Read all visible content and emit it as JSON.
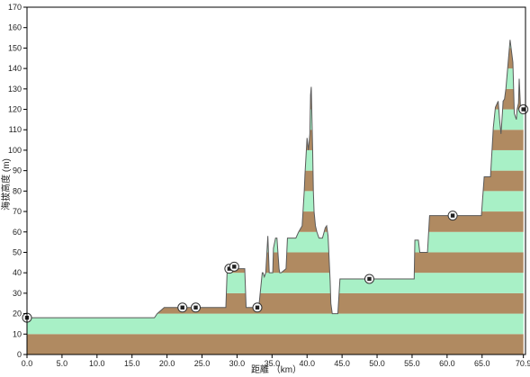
{
  "chart_data": {
    "type": "area",
    "title": "",
    "xlabel": "距離 （km）",
    "ylabel": "海拔高度 (m)",
    "xlim": [
      0,
      71.2
    ],
    "ylim": [
      0,
      170
    ],
    "x_ticks": [
      "0.0",
      "5.0",
      "10.0",
      "15.0",
      "20.0",
      "25.0",
      "30.0",
      "35.0",
      "40.0",
      "45.0",
      "50.0",
      "55.0",
      "60.0",
      "65.0",
      "70.9"
    ],
    "x_tick_values": [
      0,
      5,
      10,
      15,
      20,
      25,
      30,
      35,
      40,
      45,
      50,
      55,
      60,
      65,
      70.9
    ],
    "y_ticks": [
      "0",
      "10",
      "20",
      "30",
      "40",
      "50",
      "60",
      "70",
      "80",
      "90",
      "100",
      "110",
      "120",
      "130",
      "140",
      "150",
      "160",
      "170"
    ],
    "y_tick_values": [
      0,
      10,
      20,
      30,
      40,
      50,
      60,
      70,
      80,
      90,
      100,
      110,
      120,
      130,
      140,
      150,
      160,
      170
    ],
    "band_height": 10,
    "band_colors": [
      "#b08a61",
      "#a8f0c6"
    ],
    "line_color": "#5a5a5a",
    "grid": false,
    "series": [
      {
        "x": [
          0,
          18.2,
          18.6,
          19.6,
          28.4,
          28.6,
          31.1,
          31.3,
          32.9,
          33.1,
          33.6,
          33.7,
          33.9,
          34.1,
          34.4,
          34.6,
          35.1,
          35.2,
          35.5,
          35.7,
          36.0,
          36.1,
          36.3,
          37.0,
          37.2,
          37.4,
          37.8,
          38.1,
          38.4,
          38.8,
          39.3,
          39.6,
          39.7,
          39.9,
          40.0,
          40.2,
          40.4,
          40.5,
          40.6,
          40.8,
          40.9,
          41.0,
          41.2,
          41.4,
          41.7,
          42.0,
          42.2,
          42.6,
          42.8,
          43.0,
          43.3,
          43.4,
          43.6,
          43.8,
          44.1,
          44.4,
          44.7,
          45.0,
          45.2,
          45.3,
          45.6,
          55.3,
          55.4,
          55.9,
          56.1,
          56.3,
          57.2,
          57.5,
          57.6,
          64.7,
          64.9,
          65.3,
          65.7,
          66.0,
          66.2,
          66.6,
          66.9,
          67.3,
          67.5,
          67.7,
          67.9,
          68.0,
          68.2,
          68.4,
          68.7,
          69.0,
          69.4,
          69.6,
          69.8,
          69.9,
          70.0,
          70.2,
          70.3,
          70.5,
          70.9
        ],
        "y": [
          18,
          18,
          20,
          23,
          23,
          42,
          42,
          23,
          23,
          23,
          40,
          40,
          38,
          40,
          58,
          40,
          40,
          52,
          57,
          57,
          42,
          40,
          40,
          42,
          57,
          57,
          57,
          57,
          57,
          60,
          63,
          80,
          88,
          100,
          106,
          100,
          108,
          127,
          131,
          100,
          80,
          70,
          63,
          60,
          57,
          57,
          57,
          62,
          63,
          58,
          36,
          25,
          20,
          20,
          20,
          20,
          37,
          37,
          37,
          37,
          37,
          37,
          56,
          56,
          50,
          50,
          50,
          68,
          68,
          68,
          68,
          87,
          87,
          87,
          87,
          111,
          121,
          124,
          115,
          108,
          118,
          124,
          125,
          130,
          142,
          154,
          143,
          118,
          116,
          115,
          120,
          123,
          135,
          120,
          120
        ]
      }
    ],
    "markers": [
      {
        "x": 0.0,
        "y": 18
      },
      {
        "x": 22.2,
        "y": 23
      },
      {
        "x": 24.1,
        "y": 23
      },
      {
        "x": 28.9,
        "y": 42
      },
      {
        "x": 29.6,
        "y": 43
      },
      {
        "x": 32.9,
        "y": 23
      },
      {
        "x": 48.9,
        "y": 37
      },
      {
        "x": 60.8,
        "y": 68
      },
      {
        "x": 70.9,
        "y": 120
      }
    ]
  }
}
